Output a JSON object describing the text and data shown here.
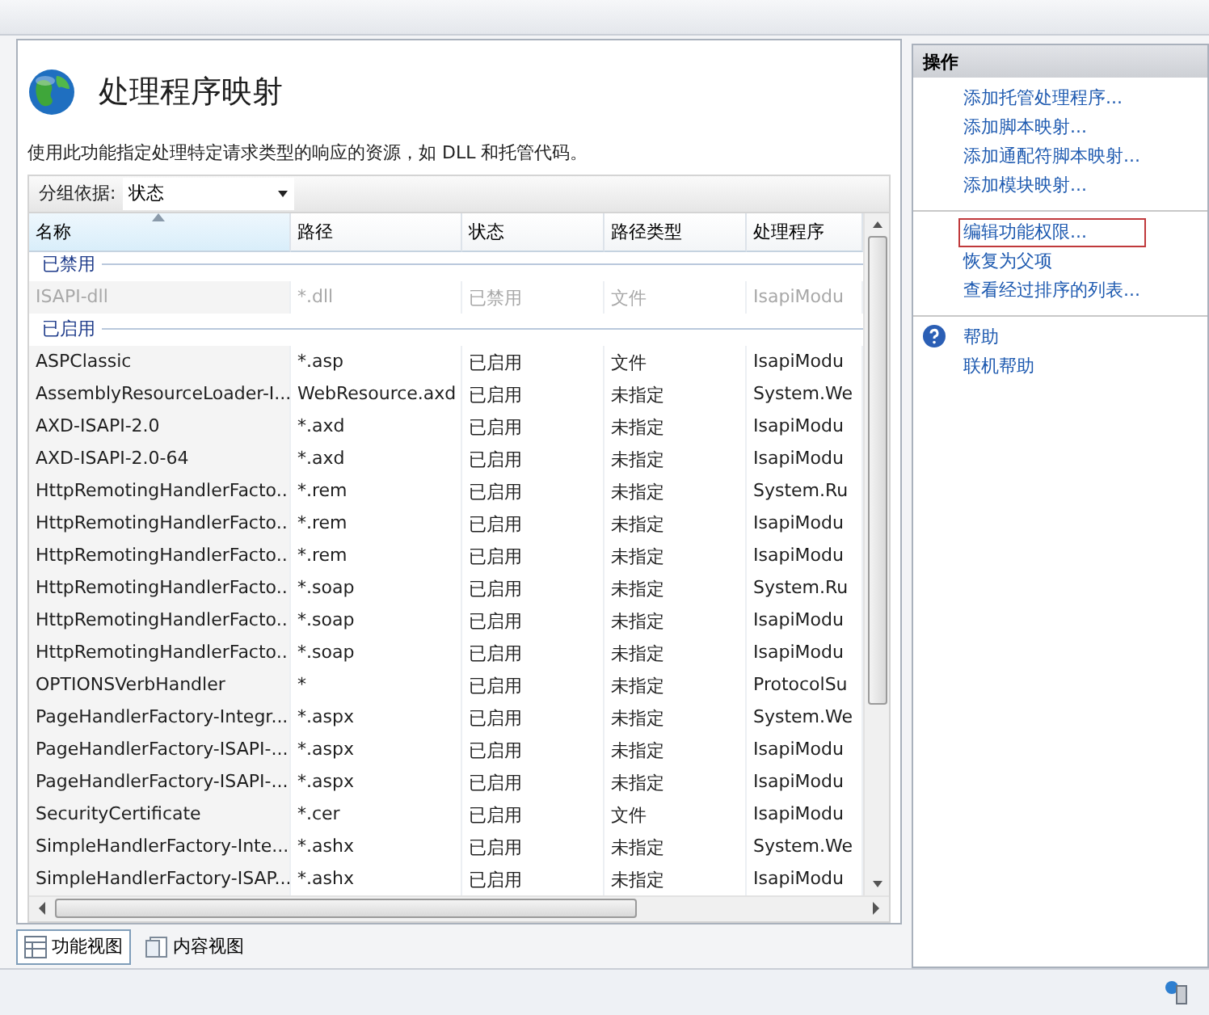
{
  "page": {
    "title": "处理程序映射",
    "description": "使用此功能指定处理特定请求类型的响应的资源，如 DLL 和托管代码。"
  },
  "group_by": {
    "label": "分组依据:",
    "value": "状态"
  },
  "table": {
    "columns": [
      {
        "label": "名称",
        "sorted": true
      },
      {
        "label": "路径",
        "sorted": false
      },
      {
        "label": "状态",
        "sorted": false
      },
      {
        "label": "路径类型",
        "sorted": false
      },
      {
        "label": "处理程序",
        "sorted": false
      }
    ],
    "groups": [
      {
        "label": "已禁用",
        "disabled": true,
        "rows": [
          [
            "ISAPI-dll",
            "*.dll",
            "已禁用",
            "文件",
            "IsapiModu"
          ]
        ]
      },
      {
        "label": "已启用",
        "disabled": false,
        "rows": [
          [
            "ASPClassic",
            "*.asp",
            "已启用",
            "文件",
            "IsapiModu"
          ],
          [
            "AssemblyResourceLoader-I...",
            "WebResource.axd",
            "已启用",
            "未指定",
            "System.We"
          ],
          [
            "AXD-ISAPI-2.0",
            "*.axd",
            "已启用",
            "未指定",
            "IsapiModu"
          ],
          [
            "AXD-ISAPI-2.0-64",
            "*.axd",
            "已启用",
            "未指定",
            "IsapiModu"
          ],
          [
            "HttpRemotingHandlerFacto...",
            "*.rem",
            "已启用",
            "未指定",
            "System.Ru"
          ],
          [
            "HttpRemotingHandlerFacto...",
            "*.rem",
            "已启用",
            "未指定",
            "IsapiModu"
          ],
          [
            "HttpRemotingHandlerFacto...",
            "*.rem",
            "已启用",
            "未指定",
            "IsapiModu"
          ],
          [
            "HttpRemotingHandlerFacto...",
            "*.soap",
            "已启用",
            "未指定",
            "System.Ru"
          ],
          [
            "HttpRemotingHandlerFacto...",
            "*.soap",
            "已启用",
            "未指定",
            "IsapiModu"
          ],
          [
            "HttpRemotingHandlerFacto...",
            "*.soap",
            "已启用",
            "未指定",
            "IsapiModu"
          ],
          [
            "OPTIONSVerbHandler",
            "*",
            "已启用",
            "未指定",
            "ProtocolSu"
          ],
          [
            "PageHandlerFactory-Integr...",
            "*.aspx",
            "已启用",
            "未指定",
            "System.We"
          ],
          [
            "PageHandlerFactory-ISAPI-...",
            "*.aspx",
            "已启用",
            "未指定",
            "IsapiModu"
          ],
          [
            "PageHandlerFactory-ISAPI-...",
            "*.aspx",
            "已启用",
            "未指定",
            "IsapiModu"
          ],
          [
            "SecurityCertificate",
            "*.cer",
            "已启用",
            "文件",
            "IsapiModu"
          ],
          [
            "SimpleHandlerFactory-Inte...",
            "*.ashx",
            "已启用",
            "未指定",
            "System.We"
          ],
          [
            "SimpleHandlerFactory-ISAP...",
            "*.ashx",
            "已启用",
            "未指定",
            "IsapiModu"
          ]
        ]
      }
    ]
  },
  "view_tabs": [
    {
      "label": "功能视图",
      "selected": true
    },
    {
      "label": "内容视图",
      "selected": false
    }
  ],
  "actions": {
    "title": "操作",
    "sections": [
      {
        "kind": "links",
        "items": [
          {
            "label": "添加托管处理程序...",
            "highlighted": false
          },
          {
            "label": "添加脚本映射...",
            "highlighted": false
          },
          {
            "label": "添加通配符脚本映射...",
            "highlighted": false
          },
          {
            "label": "添加模块映射...",
            "highlighted": false
          }
        ]
      },
      {
        "kind": "links",
        "items": [
          {
            "label": "编辑功能权限...",
            "highlighted": true
          },
          {
            "label": "恢复为父项",
            "highlighted": false
          },
          {
            "label": "查看经过排序的列表...",
            "highlighted": false
          }
        ]
      },
      {
        "kind": "help",
        "items": [
          {
            "label": "帮助",
            "highlighted": false
          },
          {
            "label": "联机帮助",
            "highlighted": false
          }
        ]
      }
    ]
  }
}
